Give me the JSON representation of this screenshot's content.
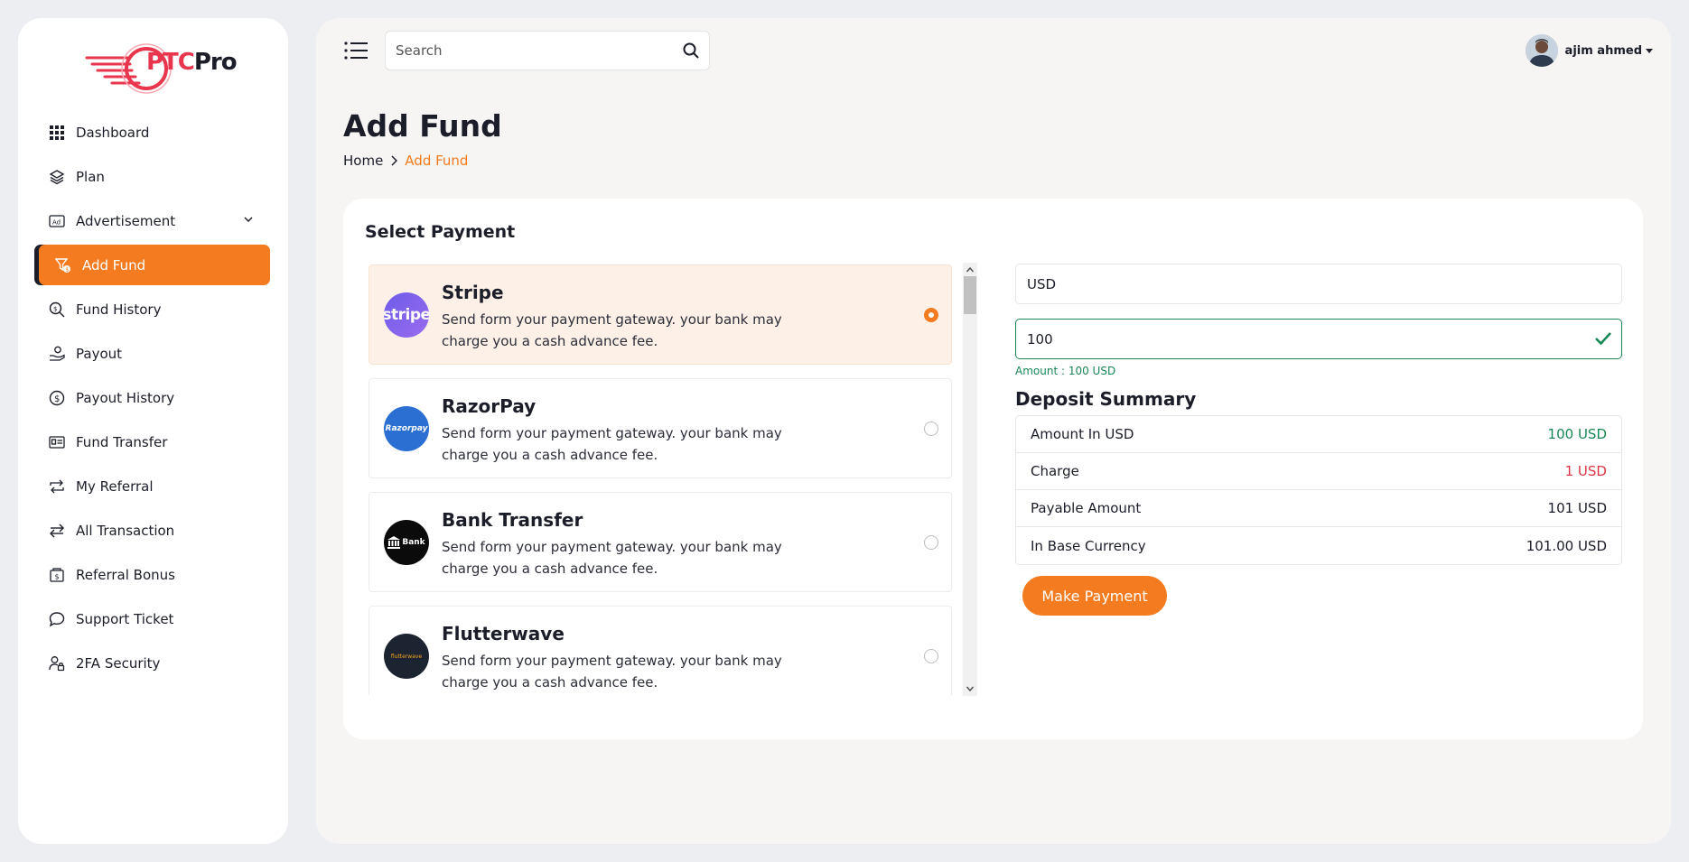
{
  "brand": {
    "logo_ptc": "PTC",
    "logo_pro": "Pro",
    "accent": "#f47b1f"
  },
  "sidebar": {
    "items": [
      {
        "label": "Dashboard",
        "icon": "grid-icon"
      },
      {
        "label": "Plan",
        "icon": "layers-icon"
      },
      {
        "label": "Advertisement",
        "icon": "ad-icon"
      },
      {
        "label": "Add Fund",
        "icon": "funnel-dollar-icon"
      },
      {
        "label": "Fund History",
        "icon": "search-dollar-icon"
      },
      {
        "label": "Payout",
        "icon": "hand-coin-icon"
      },
      {
        "label": "Payout History",
        "icon": "dollar-circle-icon"
      },
      {
        "label": "Fund Transfer",
        "icon": "id-card-icon"
      },
      {
        "label": "My Referral",
        "icon": "repeat-icon"
      },
      {
        "label": "All Transaction",
        "icon": "arrows-exchange-icon"
      },
      {
        "label": "Referral Bonus",
        "icon": "receipt-dollar-icon"
      },
      {
        "label": "Support Ticket",
        "icon": "chat-bubble-icon"
      },
      {
        "label": "2FA Security",
        "icon": "user-lock-icon"
      }
    ]
  },
  "header": {
    "search_placeholder": "Search",
    "user_name": "ajim ahmed"
  },
  "page": {
    "title": "Add Fund",
    "breadcrumb_home": "Home",
    "breadcrumb_current": "Add Fund"
  },
  "payment": {
    "section_title": "Select Payment",
    "gateways": [
      {
        "name": "Stripe",
        "logo_text": "stripe",
        "desc": "Send form your payment gateway. your bank may charge you a cash advance fee.",
        "selected": true
      },
      {
        "name": "RazorPay",
        "logo_text": "Razorpay",
        "desc": "Send form your payment gateway. your bank may charge you a cash advance fee.",
        "selected": false
      },
      {
        "name": "Bank Transfer",
        "logo_text": "Bank",
        "desc": "Send form your payment gateway. your bank may charge you a cash advance fee.",
        "selected": false
      },
      {
        "name": "Flutterwave",
        "logo_text": "flutterwave",
        "desc": "Send form your payment gateway. your bank may charge you a cash advance fee.",
        "selected": false
      }
    ]
  },
  "form": {
    "currency": "USD",
    "amount": "100",
    "amount_note": "Amount : 100 USD",
    "summary_title": "Deposit Summary",
    "summary": [
      {
        "label": "Amount In USD",
        "value": "100 USD"
      },
      {
        "label": "Charge",
        "value": "1 USD"
      },
      {
        "label": "Payable Amount",
        "value": "101 USD"
      },
      {
        "label": "In Base Currency",
        "value": "101.00 USD"
      }
    ],
    "submit_label": "Make Payment"
  }
}
